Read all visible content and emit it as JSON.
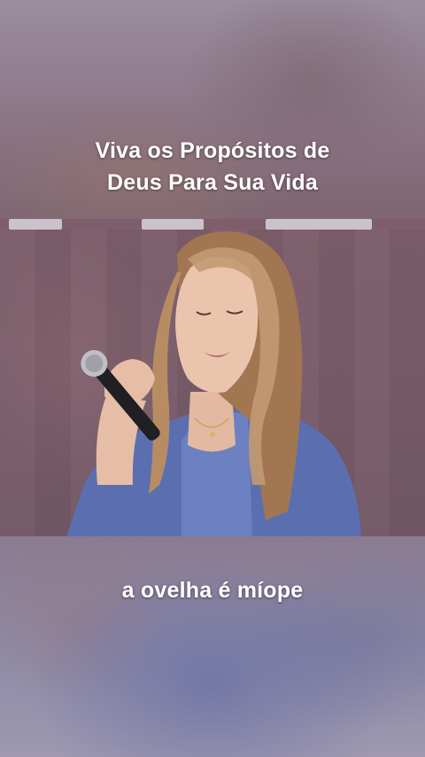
{
  "captions": {
    "top_line1": "Viva os Propósitos de",
    "top_line2": "Deus Para Sua Vida",
    "bottom": "a ovelha é míope"
  },
  "scene": {
    "subject": "woman-singing-with-microphone",
    "colors": {
      "jacket": "#5b6fb0",
      "hair": "#b08560",
      "skin": "#e8c2ad",
      "backdrop": "#7a5d69"
    }
  }
}
